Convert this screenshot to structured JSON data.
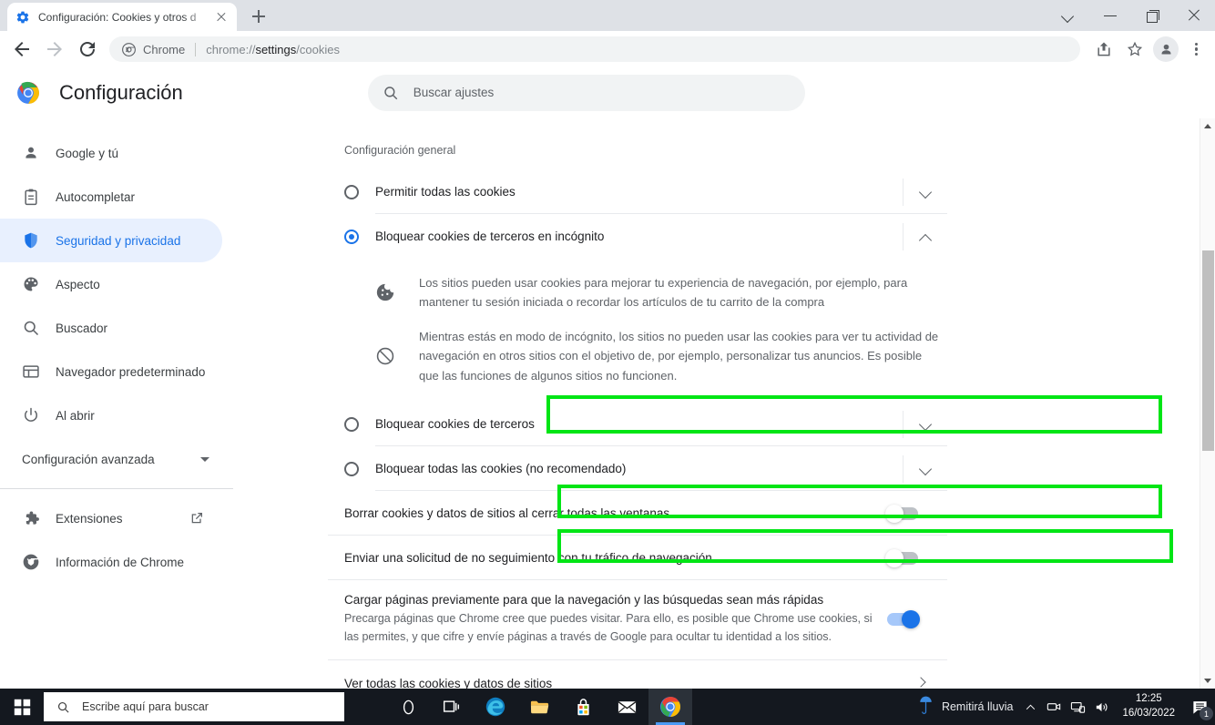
{
  "browser": {
    "tab": {
      "favicon": "gear-icon",
      "title": "Configuración: Cookies y otros d",
      "close_label": "×"
    },
    "new_tab_label": "+",
    "window_controls": {
      "tab_search": "tab-search-icon",
      "minimize": "minimize-icon",
      "maximize": "maximize-icon",
      "close": "close-icon"
    },
    "omnibox": {
      "chip_label": "Chrome",
      "url_prefix": "chrome://",
      "url_bold": "settings",
      "url_suffix": "/cookies"
    },
    "toolbar_icons": {
      "back": "back-arrow-icon",
      "forward": "forward-arrow-icon",
      "reload": "reload-icon",
      "share": "share-icon",
      "bookmark": "star-icon",
      "profile": "avatar-icon",
      "menu": "kebab-menu-icon"
    }
  },
  "settings": {
    "logo": "chrome-logo-icon",
    "title": "Configuración",
    "search": {
      "placeholder": "Buscar ajustes",
      "icon": "search-icon",
      "value": ""
    }
  },
  "sidebar": {
    "items": [
      {
        "label": "Google y tú",
        "icon": "person-icon",
        "active": false
      },
      {
        "label": "Autocompletar",
        "icon": "clipboard-icon",
        "active": false
      },
      {
        "label": "Seguridad y privacidad",
        "icon": "shield-icon",
        "active": true
      },
      {
        "label": "Aspecto",
        "icon": "palette-icon",
        "active": false
      },
      {
        "label": "Buscador",
        "icon": "search-icon",
        "active": false
      },
      {
        "label": "Navegador predeterminado",
        "icon": "browser-window-icon",
        "active": false
      },
      {
        "label": "Al abrir",
        "icon": "power-icon",
        "active": false
      }
    ],
    "advanced": {
      "label": "Configuración avanzada",
      "icon": "chevron-down-icon"
    },
    "footer": [
      {
        "label": "Extensiones",
        "icon": "puzzle-icon",
        "external": "external-link-icon"
      },
      {
        "label": "Información de Chrome",
        "icon": "chrome-logo-icon",
        "external": ""
      }
    ]
  },
  "main": {
    "section_label": "Configuración general",
    "options": [
      {
        "label": "Permitir todas las cookies",
        "selected": false,
        "expanded": false,
        "chevron": "chevron-down-icon"
      },
      {
        "label": "Bloquear cookies de terceros en incógnito",
        "selected": true,
        "expanded": true,
        "chevron": "chevron-up-icon"
      },
      {
        "label": "Bloquear cookies de terceros",
        "selected": false,
        "expanded": false,
        "chevron": "chevron-down-icon",
        "highlighted": true
      },
      {
        "label": "Bloquear todas las cookies (no recomendado)",
        "selected": false,
        "expanded": false,
        "chevron": "chevron-down-icon"
      }
    ],
    "descriptions": [
      {
        "icon": "cookie-icon",
        "text": "Los sitios pueden usar cookies para mejorar tu experiencia de navegación, por ejemplo, para mantener tu sesión iniciada o recordar los artículos de tu carrito de la compra"
      },
      {
        "icon": "block-icon",
        "text": "Mientras estás en modo de incógnito, los sitios no pueden usar las cookies para ver tu actividad de navegación en otros sitios con el objetivo de, por ejemplo, personalizar tus anuncios. Es posible que las funciones de algunos sitios no funcionen."
      }
    ],
    "toggles": [
      {
        "label": "Borrar cookies y datos de sitios al cerrar todas las ventanas",
        "on": false,
        "highlighted": true
      },
      {
        "label": "Enviar una solicitud de no seguimiento con tu tráfico de navegación",
        "on": false,
        "highlighted": true
      }
    ],
    "preload": {
      "title": "Cargar páginas previamente para que la navegación y las búsquedas sean más rápidas",
      "subtitle": "Precarga páginas que Chrome cree que puedes visitar. Para ello, es posible que Chrome use cookies, si las permites, y que cifre y envíe páginas a través de Google para ocultar tu identidad a los sitios.",
      "on": true
    },
    "link_row": {
      "label": "Ver todas las cookies y datos de sitios",
      "icon": "chevron-right-icon"
    }
  },
  "annotations": {
    "highlight_color": "#00e515",
    "count": 3
  },
  "taskbar": {
    "start": "windows-start-icon",
    "search": {
      "placeholder": "Escribe aquí para buscar",
      "icon": "search-icon"
    },
    "apps": [
      {
        "name": "cortana-icon",
        "active": false
      },
      {
        "name": "task-view-icon",
        "active": false
      },
      {
        "name": "edge-icon",
        "active": false
      },
      {
        "name": "file-explorer-icon",
        "active": false
      },
      {
        "name": "microsoft-store-icon",
        "active": false
      },
      {
        "name": "mail-icon",
        "active": false
      },
      {
        "name": "chrome-icon",
        "active": true
      }
    ],
    "weather": {
      "icon": "umbrella-icon",
      "label": "Remitirá lluvia"
    },
    "tray_icons": [
      "chevron-up-icon",
      "camera-icon",
      "network-icon",
      "volume-icon"
    ],
    "clock": {
      "time": "12:25",
      "date": "16/03/2022"
    },
    "notifications": {
      "icon": "notification-icon",
      "count": "1"
    }
  }
}
